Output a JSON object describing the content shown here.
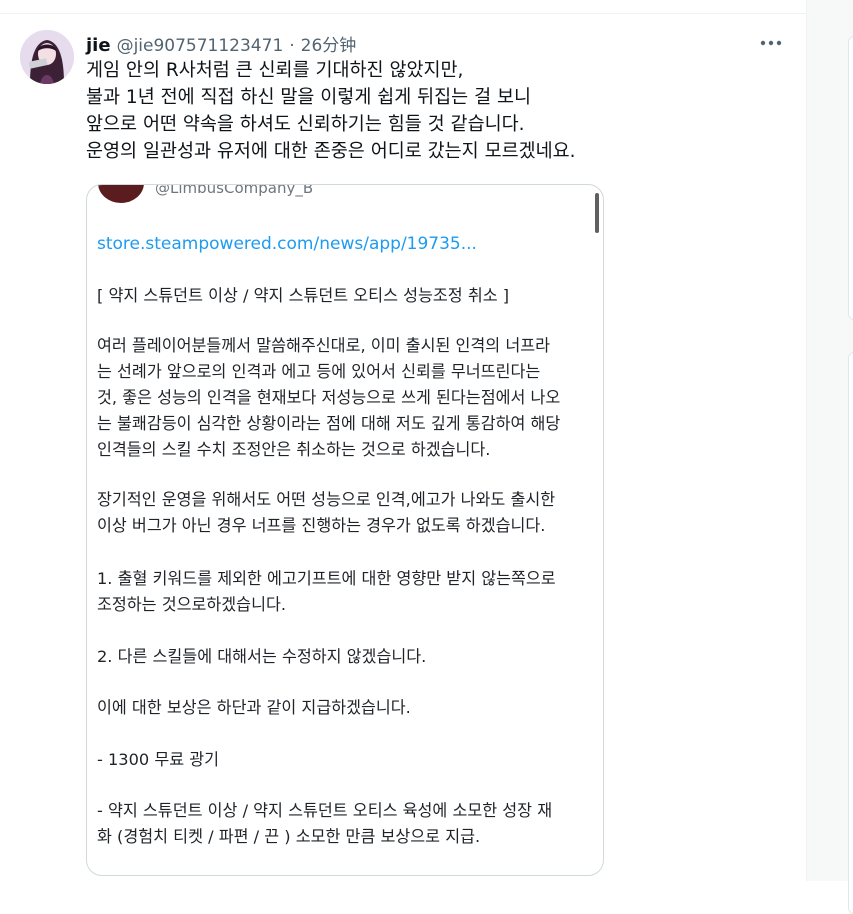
{
  "tweet": {
    "display_name": "jie",
    "handle": "@jie907571123471",
    "separator": "·",
    "timestamp": "26分钟",
    "more_icon": "more-horizontal-icon",
    "lines": [
      "게임 안의 R사처럼 큰 신뢰를 기대하진 않았지만,",
      "불과 1년 전에 직접 하신 말을 이렇게 쉽게 뒤집는 걸 보니",
      "앞으로 어떤 약속을 하셔도 신뢰하기는 힘들 것 같습니다.",
      "운영의 일관성과 유저에 대한 존중은 어디로 갔는지 모르겠네요."
    ]
  },
  "embed": {
    "handle": "@LimbusCompany_B",
    "link": "store.steampowered.com/news/app/19735...",
    "title": "[ 약지 스튜던트 이상 / 약지 스튜던트 오티스 성능조정 취소 ]",
    "para1": [
      "여러 플레이어분들께서 말씀해주신대로, 이미 출시된 인격의 너프라",
      "는 선례가 앞으로의 인격과 에고 등에 있어서 신뢰를 무너뜨린다는",
      "것, 좋은 성능의 인격을 현재보다 저성능으로 쓰게 된다는점에서 나오",
      "는 불쾌감등이 심각한 상황이라는 점에 대해 저도 깊게 통감하여 해당",
      "인격들의 스킬 수치 조정안은 취소하는 것으로 하겠습니다."
    ],
    "para2": [
      "장기적인 운영을 위해서도 어떤 성능으로 인격,에고가 나와도 출시한",
      "이상 버그가 아닌 경우 너프를 진행하는 경우가 없도록 하겠습니다."
    ],
    "item1": [
      "1. 출혈 키워드를 제외한 에고기프트에 대한 영향만 받지 않는쪽으로",
      "조정하는 것으로하겠습니다."
    ],
    "item2": "2. 다른 스킬들에 대해서는 수정하지 않겠습니다.",
    "compensation_intro": "이에 대한 보상은 하단과 같이 지급하겠습니다.",
    "reward1": "- 1300 무료 광기",
    "reward2": [
      "- 약지 스튜던트 이상 / 약지 스튜던트 오티스 육성에 소모한 성장 재",
      "화 (경험치 티켓 / 파편 / 끈 ) 소모한 만큼 보상으로 지급."
    ]
  }
}
